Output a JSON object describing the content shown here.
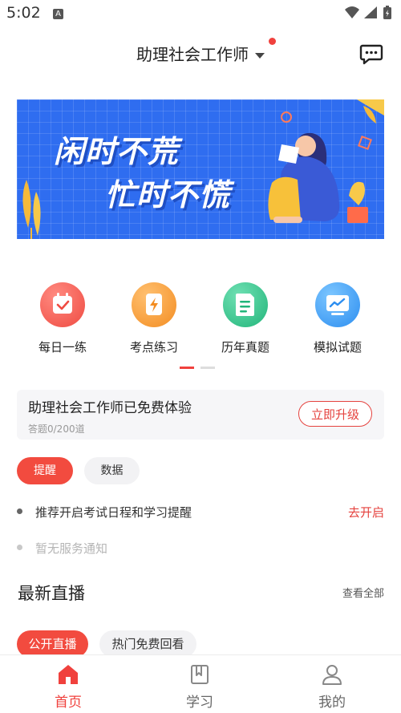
{
  "status_bar": {
    "time": "5:02",
    "a_badge": "A"
  },
  "header": {
    "title": "助理社会工作师"
  },
  "banner": {
    "line1": "闲时不荒",
    "line2": "忙时不慌"
  },
  "features": [
    {
      "label": "每日一练",
      "color": "#f0514a"
    },
    {
      "label": "考点练习",
      "color": "#f59a2d"
    },
    {
      "label": "历年真题",
      "color": "#2fc48b"
    },
    {
      "label": "模拟试题",
      "color": "#3b9ef2"
    }
  ],
  "trial": {
    "title": "助理社会工作师已免费体验",
    "progress": "答题0/200道",
    "upgrade_label": "立即升级"
  },
  "notice_tabs": {
    "reminder": "提醒",
    "data": "数据"
  },
  "notices": {
    "item1": "推荐开启考试日程和学习提醒",
    "item1_action": "去开启",
    "item2": "暂无服务通知"
  },
  "live": {
    "title": "最新直播",
    "view_all": "查看全部",
    "tab_public": "公开直播",
    "tab_replay": "热门免费回看"
  },
  "bottom_nav": {
    "home": "首页",
    "study": "学习",
    "mine": "我的"
  },
  "colors": {
    "accent": "#f0413d",
    "banner_blue": "#2f6df0"
  }
}
